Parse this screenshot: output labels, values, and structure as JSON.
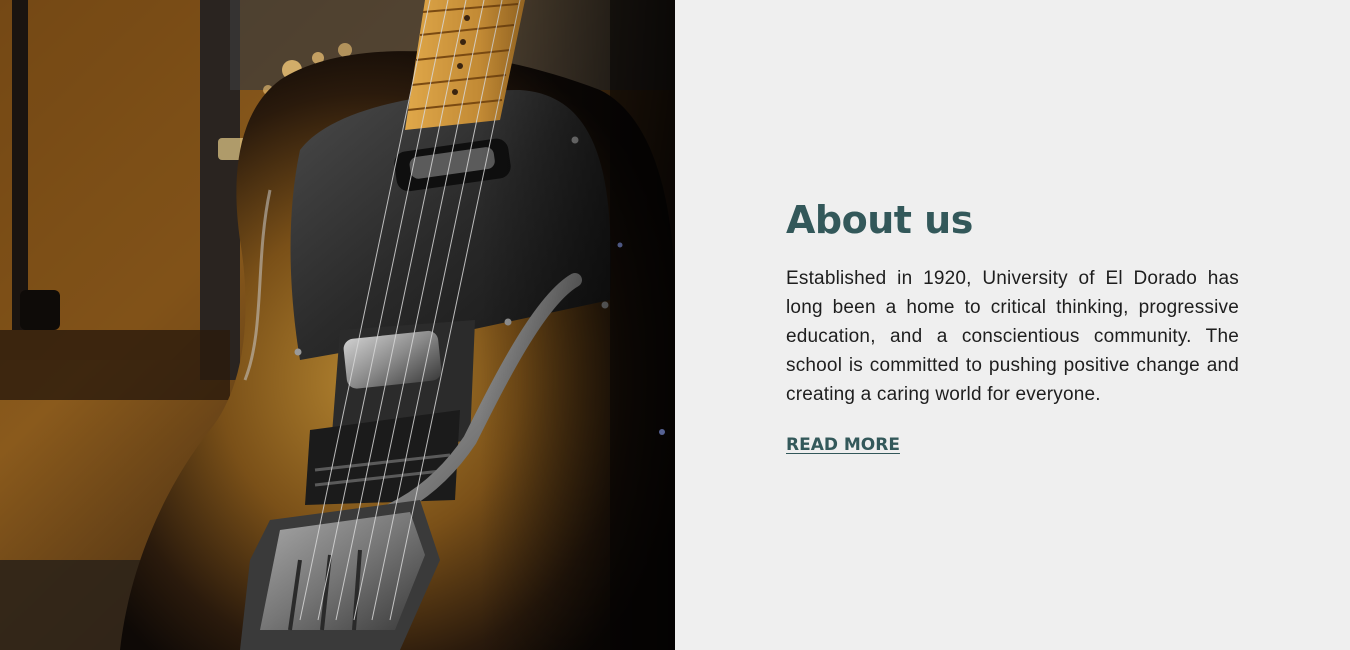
{
  "about": {
    "heading": "About us",
    "body": "Established in 1920, University of El Dorado has long been a home to critical thinking, progressive education, and a conscientious community. The school is committed to pushing positive change and creating a caring world for everyone.",
    "read_more_label": "READ MORE"
  },
  "colors": {
    "heading": "#33585a",
    "link": "#33585a",
    "text": "#1e1e1e",
    "panel_background": "#efefef"
  }
}
